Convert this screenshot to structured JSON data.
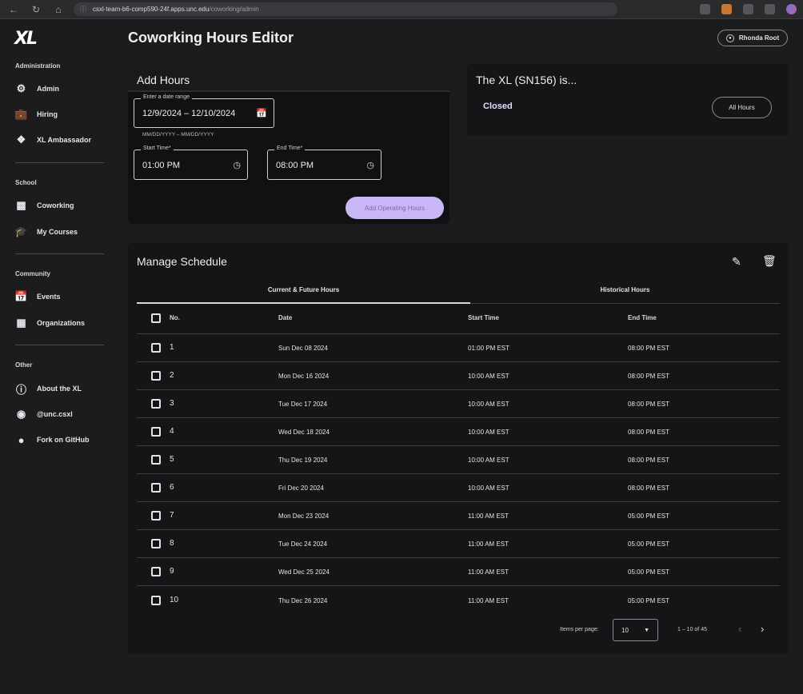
{
  "browser": {
    "url": "https://csxl-team-b6-comp590-24f.apps.unc.edu/coworking/admin",
    "url_host": "csxl-team-b6-comp590-24f.apps.unc.edu",
    "url_path": "/coworking/admin"
  },
  "sidebar": {
    "logo": "XL",
    "sections": [
      {
        "title": "Administration",
        "items": [
          {
            "label": "Admin",
            "icon": "gear-icon"
          },
          {
            "label": "Hiring",
            "icon": "briefcase-icon"
          },
          {
            "label": "XL Ambassador",
            "icon": "badge-icon"
          }
        ]
      },
      {
        "title": "School",
        "items": [
          {
            "label": "Coworking",
            "icon": "group-icon"
          },
          {
            "label": "My Courses",
            "icon": "school-icon"
          }
        ]
      },
      {
        "title": "Community",
        "items": [
          {
            "label": "Events",
            "icon": "calendar-icon"
          },
          {
            "label": "Organizations",
            "icon": "organizations-icon"
          }
        ]
      },
      {
        "title": "Other",
        "items": [
          {
            "label": "About the XL",
            "icon": "info-icon"
          },
          {
            "label": "@unc.csxl",
            "icon": "instagram-icon"
          },
          {
            "label": "Fork on GitHub",
            "icon": "github-icon"
          }
        ]
      }
    ]
  },
  "header": {
    "title": "Coworking Hours Editor",
    "user": "Rhonda Root"
  },
  "add_hours": {
    "title": "Add Hours",
    "date_range_label": "Enter a date range",
    "date_range_value": "12/9/2024 – 12/10/2024",
    "date_hint": "MM/DD/YYYY – MM/DD/YYYY",
    "start_label": "Start Time*",
    "start_value": "01:00 PM",
    "end_label": "End Time*",
    "end_value": "08:00 PM",
    "submit_label": "Add Operating Hours"
  },
  "status": {
    "title": "The XL (SN156) is...",
    "state": "Closed",
    "all_hours_label": "All Hours"
  },
  "schedule": {
    "title": "Manage Schedule",
    "tabs": [
      "Current & Future Hours",
      "Historical Hours"
    ],
    "columns": [
      "No.",
      "Date",
      "Start Time",
      "End Time"
    ],
    "rows": [
      {
        "no": "1",
        "date": "Sun Dec 08 2024",
        "start": "01:00 PM EST",
        "end": "08:00 PM EST"
      },
      {
        "no": "2",
        "date": "Mon Dec 16 2024",
        "start": "10:00 AM EST",
        "end": "08:00 PM EST"
      },
      {
        "no": "3",
        "date": "Tue Dec 17 2024",
        "start": "10:00 AM EST",
        "end": "08:00 PM EST"
      },
      {
        "no": "4",
        "date": "Wed Dec 18 2024",
        "start": "10:00 AM EST",
        "end": "08:00 PM EST"
      },
      {
        "no": "5",
        "date": "Thu Dec 19 2024",
        "start": "10:00 AM EST",
        "end": "08:00 PM EST"
      },
      {
        "no": "6",
        "date": "Fri Dec 20 2024",
        "start": "10:00 AM EST",
        "end": "08:00 PM EST"
      },
      {
        "no": "7",
        "date": "Mon Dec 23 2024",
        "start": "11:00 AM EST",
        "end": "05:00 PM EST"
      },
      {
        "no": "8",
        "date": "Tue Dec 24 2024",
        "start": "11:00 AM EST",
        "end": "05:00 PM EST"
      },
      {
        "no": "9",
        "date": "Wed Dec 25 2024",
        "start": "11:00 AM EST",
        "end": "05:00 PM EST"
      },
      {
        "no": "10",
        "date": "Thu Dec 26 2024",
        "start": "11:00 AM EST",
        "end": "05:00 PM EST"
      }
    ],
    "items_per_page_label": "Items per page:",
    "items_per_page": "10",
    "range": "1 – 10 of 45"
  }
}
